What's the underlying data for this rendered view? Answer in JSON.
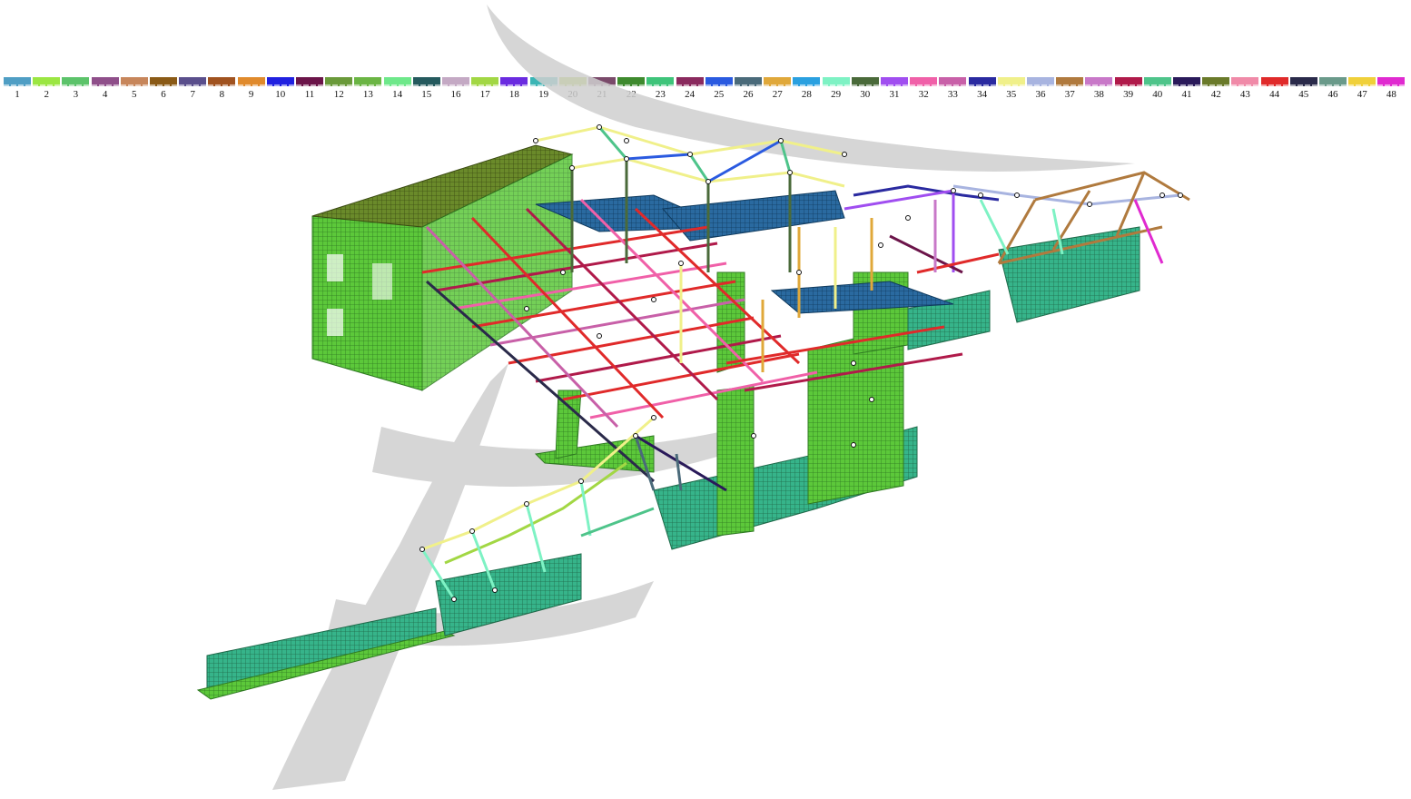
{
  "legend": {
    "items": [
      {
        "label": "1",
        "color": "#4f9ec4"
      },
      {
        "label": "2",
        "color": "#9be642"
      },
      {
        "label": "3",
        "color": "#5cc36a"
      },
      {
        "label": "4",
        "color": "#8f4f8a"
      },
      {
        "label": "5",
        "color": "#c7865b"
      },
      {
        "label": "6",
        "color": "#8a5a16"
      },
      {
        "label": "7",
        "color": "#5a4f8c"
      },
      {
        "label": "8",
        "color": "#a0521f"
      },
      {
        "label": "9",
        "color": "#e08a2c"
      },
      {
        "label": "10",
        "color": "#2020e0"
      },
      {
        "label": "11",
        "color": "#6b1449"
      },
      {
        "label": "12",
        "color": "#6a9a3a"
      },
      {
        "label": "13",
        "color": "#6bb544"
      },
      {
        "label": "14",
        "color": "#6ee88a"
      },
      {
        "label": "15",
        "color": "#255a5e"
      },
      {
        "label": "16",
        "color": "#c4a9c4"
      },
      {
        "label": "17",
        "color": "#a2d744"
      },
      {
        "label": "18",
        "color": "#6a2be0"
      },
      {
        "label": "19",
        "color": "#3ab5b5"
      },
      {
        "label": "20",
        "color": "#a8c938"
      },
      {
        "label": "21",
        "color": "#7a4a6a"
      },
      {
        "label": "22",
        "color": "#3e8a2e"
      },
      {
        "label": "23",
        "color": "#3ec47a"
      },
      {
        "label": "24",
        "color": "#8a2a5e"
      },
      {
        "label": "25",
        "color": "#2a5ae0"
      },
      {
        "label": "26",
        "color": "#4a6a7a"
      },
      {
        "label": "27",
        "color": "#e0a83a"
      },
      {
        "label": "28",
        "color": "#2aa0e0"
      },
      {
        "label": "29",
        "color": "#7ef2c4"
      },
      {
        "label": "30",
        "color": "#4a6a3a"
      },
      {
        "label": "31",
        "color": "#a04ef0"
      },
      {
        "label": "32",
        "color": "#f060a8"
      },
      {
        "label": "33",
        "color": "#c860a8"
      },
      {
        "label": "34",
        "color": "#2a2aa0"
      },
      {
        "label": "35",
        "color": "#f0f08a"
      },
      {
        "label": "36",
        "color": "#a8b4e0"
      },
      {
        "label": "37",
        "color": "#b07a3e"
      },
      {
        "label": "38",
        "color": "#c878c8"
      },
      {
        "label": "39",
        "color": "#b01a4a"
      },
      {
        "label": "40",
        "color": "#4ec48a"
      },
      {
        "label": "41",
        "color": "#2a1a5a"
      },
      {
        "label": "42",
        "color": "#6a7a2a"
      },
      {
        "label": "43",
        "color": "#f08aa8"
      },
      {
        "label": "44",
        "color": "#e02a2a"
      },
      {
        "label": "45",
        "color": "#2a2a4a"
      },
      {
        "label": "46",
        "color": "#6a9a8a"
      },
      {
        "label": "47",
        "color": "#f0d03a"
      },
      {
        "label": "48",
        "color": "#e02ad0"
      }
    ]
  },
  "colors": {
    "mesh_green": "#5cc83a",
    "mesh_teal": "#2aa888",
    "mesh_dark": "#2a6a3a",
    "watermark": "#cccccc"
  }
}
